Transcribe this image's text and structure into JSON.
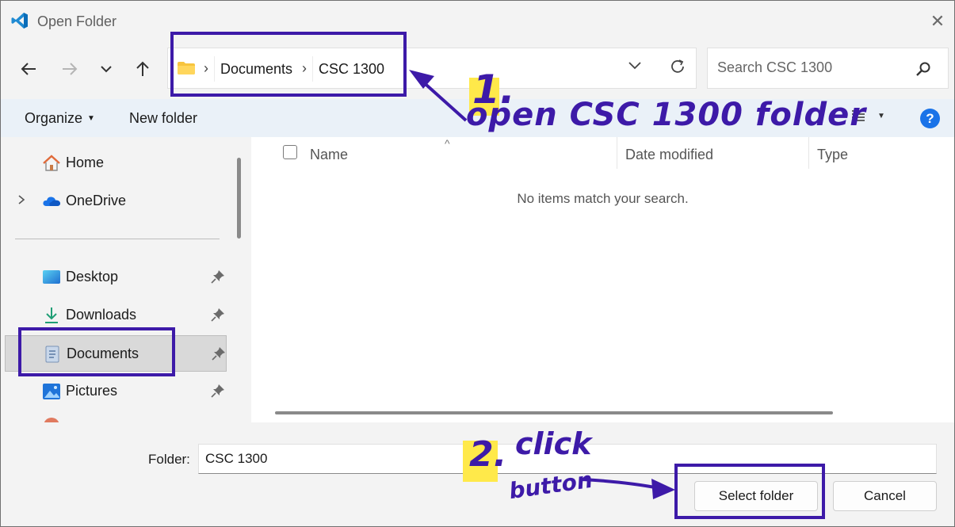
{
  "window": {
    "title": "Open Folder",
    "close_glyph": "✕"
  },
  "breadcrumb": {
    "items": [
      "Documents",
      "CSC 1300"
    ],
    "separator": "›"
  },
  "search": {
    "placeholder": "Search CSC 1300"
  },
  "command_bar": {
    "organize_label": "Organize",
    "new_folder_label": "New folder",
    "help_glyph": "?"
  },
  "sidebar": {
    "items": [
      {
        "label": "Home",
        "icon": "home-icon"
      },
      {
        "label": "OneDrive",
        "icon": "onedrive-icon"
      },
      {
        "label": "Desktop",
        "icon": "desktop-icon"
      },
      {
        "label": "Downloads",
        "icon": "downloads-icon"
      },
      {
        "label": "Documents",
        "icon": "documents-icon",
        "selected": true
      },
      {
        "label": "Pictures",
        "icon": "pictures-icon"
      }
    ]
  },
  "file_list": {
    "columns": [
      "Name",
      "Date modified",
      "Type"
    ],
    "empty_message": "No items match your search."
  },
  "footer": {
    "folder_label": "Folder:",
    "folder_value": "CSC 1300",
    "select_button": "Select folder",
    "cancel_button": "Cancel"
  },
  "annotations": {
    "step1_number": "1.",
    "step1_text": "open CSC 1300 folder",
    "step2_number": "2.",
    "step2_text_line1": "click",
    "step2_text_line2": "button"
  },
  "colors": {
    "accent": "#1a73e8",
    "annotation": "#3d1aa8",
    "highlight": "#ffe94a"
  }
}
